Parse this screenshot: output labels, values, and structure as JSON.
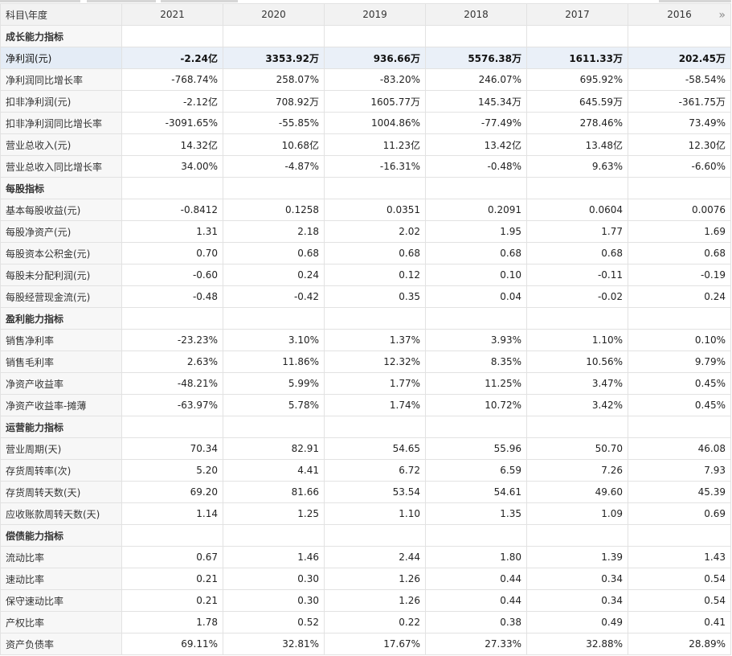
{
  "header": {
    "label": "科目\\年度",
    "years": [
      "2021",
      "2020",
      "2019",
      "2018",
      "2017",
      "2016"
    ],
    "next_icon": "double-chevron-right-icon"
  },
  "rows": [
    {
      "type": "section",
      "label": "成长能力指标"
    },
    {
      "type": "data",
      "highlight": true,
      "label": "净利润(元)",
      "values": [
        "-2.24亿",
        "3353.92万",
        "936.66万",
        "5576.38万",
        "1611.33万",
        "202.45万"
      ]
    },
    {
      "type": "data",
      "label": "净利润同比增长率",
      "values": [
        "-768.74%",
        "258.07%",
        "-83.20%",
        "246.07%",
        "695.92%",
        "-58.54%"
      ]
    },
    {
      "type": "data",
      "label": "扣非净利润(元)",
      "values": [
        "-2.12亿",
        "708.92万",
        "1605.77万",
        "145.34万",
        "645.59万",
        "-361.75万"
      ]
    },
    {
      "type": "data",
      "label": "扣非净利润同比增长率",
      "values": [
        "-3091.65%",
        "-55.85%",
        "1004.86%",
        "-77.49%",
        "278.46%",
        "73.49%"
      ]
    },
    {
      "type": "data",
      "label": "营业总收入(元)",
      "values": [
        "14.32亿",
        "10.68亿",
        "11.23亿",
        "13.42亿",
        "13.48亿",
        "12.30亿"
      ]
    },
    {
      "type": "data",
      "label": "营业总收入同比增长率",
      "values": [
        "34.00%",
        "-4.87%",
        "-16.31%",
        "-0.48%",
        "9.63%",
        "-6.60%"
      ]
    },
    {
      "type": "section",
      "label": "每股指标"
    },
    {
      "type": "data",
      "label": "基本每股收益(元)",
      "values": [
        "-0.8412",
        "0.1258",
        "0.0351",
        "0.2091",
        "0.0604",
        "0.0076"
      ]
    },
    {
      "type": "data",
      "label": "每股净资产(元)",
      "values": [
        "1.31",
        "2.18",
        "2.02",
        "1.95",
        "1.77",
        "1.69"
      ]
    },
    {
      "type": "data",
      "label": "每股资本公积金(元)",
      "values": [
        "0.70",
        "0.68",
        "0.68",
        "0.68",
        "0.68",
        "0.68"
      ]
    },
    {
      "type": "data",
      "label": "每股未分配利润(元)",
      "values": [
        "-0.60",
        "0.24",
        "0.12",
        "0.10",
        "-0.11",
        "-0.19"
      ]
    },
    {
      "type": "data",
      "label": "每股经营现金流(元)",
      "values": [
        "-0.48",
        "-0.42",
        "0.35",
        "0.04",
        "-0.02",
        "0.24"
      ]
    },
    {
      "type": "section",
      "label": "盈利能力指标"
    },
    {
      "type": "data",
      "label": "销售净利率",
      "values": [
        "-23.23%",
        "3.10%",
        "1.37%",
        "3.93%",
        "1.10%",
        "0.10%"
      ]
    },
    {
      "type": "data",
      "label": "销售毛利率",
      "values": [
        "2.63%",
        "11.86%",
        "12.32%",
        "8.35%",
        "10.56%",
        "9.79%"
      ]
    },
    {
      "type": "data",
      "label": "净资产收益率",
      "values": [
        "-48.21%",
        "5.99%",
        "1.77%",
        "11.25%",
        "3.47%",
        "0.45%"
      ]
    },
    {
      "type": "data",
      "label": "净资产收益率-摊薄",
      "values": [
        "-63.97%",
        "5.78%",
        "1.74%",
        "10.72%",
        "3.42%",
        "0.45%"
      ]
    },
    {
      "type": "section",
      "label": "运营能力指标"
    },
    {
      "type": "data",
      "label": "营业周期(天)",
      "values": [
        "70.34",
        "82.91",
        "54.65",
        "55.96",
        "50.70",
        "46.08"
      ]
    },
    {
      "type": "data",
      "label": "存货周转率(次)",
      "values": [
        "5.20",
        "4.41",
        "6.72",
        "6.59",
        "7.26",
        "7.93"
      ]
    },
    {
      "type": "data",
      "label": "存货周转天数(天)",
      "values": [
        "69.20",
        "81.66",
        "53.54",
        "54.61",
        "49.60",
        "45.39"
      ]
    },
    {
      "type": "data",
      "label": "应收账款周转天数(天)",
      "values": [
        "1.14",
        "1.25",
        "1.10",
        "1.35",
        "1.09",
        "0.69"
      ]
    },
    {
      "type": "section",
      "label": "偿债能力指标"
    },
    {
      "type": "data",
      "label": "流动比率",
      "values": [
        "0.67",
        "1.46",
        "2.44",
        "1.80",
        "1.39",
        "1.43"
      ]
    },
    {
      "type": "data",
      "label": "速动比率",
      "values": [
        "0.21",
        "0.30",
        "1.26",
        "0.44",
        "0.34",
        "0.54"
      ]
    },
    {
      "type": "data",
      "label": "保守速动比率",
      "values": [
        "0.21",
        "0.30",
        "1.26",
        "0.44",
        "0.34",
        "0.54"
      ]
    },
    {
      "type": "data",
      "label": "产权比率",
      "values": [
        "1.78",
        "0.52",
        "0.22",
        "0.38",
        "0.49",
        "0.41"
      ]
    },
    {
      "type": "data",
      "label": "资产负债率",
      "values": [
        "69.11%",
        "32.81%",
        "17.67%",
        "27.33%",
        "32.88%",
        "28.89%"
      ]
    }
  ]
}
